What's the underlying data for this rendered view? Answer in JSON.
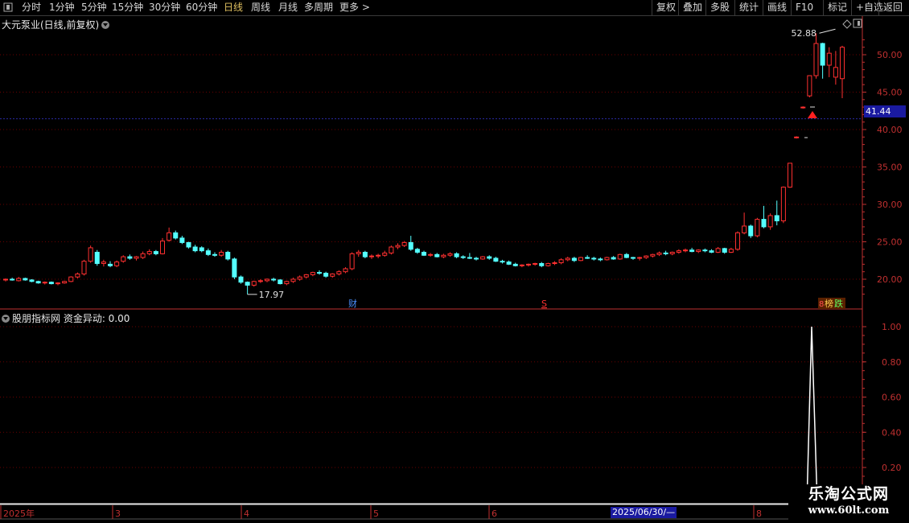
{
  "toolbar": {
    "periods": [
      "分时",
      "1分钟",
      "5分钟",
      "15分钟",
      "30分钟",
      "60分钟",
      "日线",
      "周线",
      "月线",
      "多周期",
      "更多 >"
    ],
    "active_period": "日线",
    "actions": [
      "复权",
      "叠加",
      "多股",
      "统计",
      "画线",
      "F10",
      "+自选",
      "返回"
    ],
    "marker": "标记"
  },
  "main_chart": {
    "title": "大元泵业(日线,前复权)",
    "high_label": "52.88",
    "low_label": "17.97",
    "current_price": "41.44",
    "y_ticks": [
      "50.00",
      "45.00",
      "40.00",
      "35.00",
      "30.00",
      "25.00",
      "20.00"
    ],
    "markers": {
      "cai": "财",
      "s": "S",
      "bang": "榜",
      "die": "跌"
    },
    "colors": {
      "up": "#ff3030",
      "down": "#54ffff",
      "grid": "#6a0000",
      "axis": "#c03030"
    }
  },
  "indicator": {
    "title": "股朋指标网 资金异动: 0.00",
    "y_ticks": [
      "1.00",
      "0.80",
      "0.60",
      "0.40",
      "0.20"
    ]
  },
  "time_axis": {
    "labels": [
      "2025年",
      "3",
      "4",
      "5",
      "6",
      "8"
    ],
    "cursor_date": "2025/06/30/—"
  },
  "watermark": {
    "title": "乐淘公式网",
    "url": "www.60lt.com"
  },
  "chart_data": {
    "type": "candlestick",
    "title": "大元泵业(日线,前复权)",
    "ylim": [
      17,
      54
    ],
    "candles": [
      [
        19.9,
        20.1,
        19.7,
        20.0
      ],
      [
        20.0,
        20.2,
        19.8,
        19.9
      ],
      [
        19.8,
        20.3,
        19.7,
        20.1
      ],
      [
        20.1,
        20.2,
        19.8,
        19.9
      ],
      [
        19.9,
        20.0,
        19.6,
        19.7
      ],
      [
        19.7,
        19.8,
        19.4,
        19.5
      ],
      [
        19.5,
        19.7,
        19.3,
        19.6
      ],
      [
        19.6,
        19.7,
        19.3,
        19.4
      ],
      [
        19.4,
        19.6,
        19.2,
        19.5
      ],
      [
        19.5,
        19.8,
        19.4,
        19.7
      ],
      [
        19.7,
        20.4,
        19.6,
        20.3
      ],
      [
        20.3,
        20.9,
        20.1,
        20.7
      ],
      [
        20.7,
        22.6,
        20.5,
        22.4
      ],
      [
        22.4,
        24.5,
        22.2,
        24.2
      ],
      [
        23.6,
        23.9,
        21.8,
        22.1
      ],
      [
        22.1,
        22.6,
        21.7,
        22.3
      ],
      [
        22.0,
        22.4,
        21.6,
        21.8
      ],
      [
        21.8,
        22.5,
        21.6,
        22.3
      ],
      [
        22.4,
        23.2,
        22.2,
        23.0
      ],
      [
        23.0,
        23.3,
        22.6,
        22.8
      ],
      [
        22.8,
        23.1,
        22.5,
        23.0
      ],
      [
        22.9,
        23.7,
        22.7,
        23.4
      ],
      [
        23.4,
        24.0,
        23.2,
        23.7
      ],
      [
        23.7,
        23.9,
        23.2,
        23.4
      ],
      [
        23.4,
        25.5,
        23.3,
        25.1
      ],
      [
        25.2,
        26.9,
        25.0,
        26.2
      ],
      [
        26.2,
        26.5,
        25.3,
        25.5
      ],
      [
        25.5,
        25.8,
        24.7,
        24.9
      ],
      [
        24.9,
        25.0,
        24.1,
        24.3
      ],
      [
        24.3,
        24.6,
        23.6,
        23.8
      ],
      [
        24.2,
        24.4,
        23.6,
        23.8
      ],
      [
        23.8,
        24.1,
        23.1,
        23.3
      ],
      [
        23.3,
        23.6,
        23.0,
        23.2
      ],
      [
        23.2,
        23.9,
        23.0,
        23.6
      ],
      [
        23.6,
        23.8,
        22.5,
        22.7
      ],
      [
        22.7,
        22.9,
        20.0,
        20.3
      ],
      [
        20.3,
        20.5,
        19.4,
        19.6
      ],
      [
        19.6,
        19.7,
        17.97,
        19.2
      ],
      [
        19.2,
        19.8,
        19.0,
        19.7
      ],
      [
        19.7,
        20.0,
        19.5,
        19.8
      ],
      [
        19.8,
        20.1,
        19.6,
        20.0
      ],
      [
        20.0,
        20.2,
        19.7,
        19.9
      ],
      [
        19.9,
        20.0,
        19.3,
        19.4
      ],
      [
        19.4,
        19.8,
        19.2,
        19.7
      ],
      [
        19.7,
        20.2,
        19.5,
        20.0
      ],
      [
        20.0,
        20.5,
        19.8,
        20.3
      ],
      [
        20.3,
        20.7,
        20.1,
        20.6
      ],
      [
        20.6,
        21.0,
        20.4,
        20.9
      ],
      [
        20.9,
        21.2,
        20.6,
        20.8
      ],
      [
        20.8,
        21.0,
        20.2,
        20.4
      ],
      [
        20.4,
        20.8,
        20.2,
        20.7
      ],
      [
        20.7,
        21.2,
        20.5,
        21.0
      ],
      [
        21.0,
        21.6,
        20.8,
        21.4
      ],
      [
        21.4,
        23.6,
        21.2,
        23.4
      ],
      [
        23.4,
        23.9,
        23.0,
        23.6
      ],
      [
        23.6,
        23.8,
        22.8,
        23.0
      ],
      [
        23.0,
        23.3,
        22.7,
        23.1
      ],
      [
        23.1,
        23.4,
        22.8,
        23.2
      ],
      [
        23.2,
        23.8,
        23.0,
        23.5
      ],
      [
        23.5,
        24.5,
        23.3,
        24.3
      ],
      [
        24.3,
        24.8,
        24.0,
        24.5
      ],
      [
        24.5,
        25.1,
        24.3,
        24.9
      ],
      [
        24.9,
        25.8,
        23.8,
        24.0
      ],
      [
        24.0,
        24.2,
        23.4,
        23.6
      ],
      [
        23.6,
        23.8,
        23.1,
        23.2
      ],
      [
        23.2,
        23.5,
        23.0,
        23.3
      ],
      [
        23.3,
        23.5,
        22.9,
        23.0
      ],
      [
        23.0,
        23.4,
        22.8,
        23.2
      ],
      [
        23.2,
        23.6,
        23.0,
        23.4
      ],
      [
        23.4,
        23.6,
        22.8,
        23.0
      ],
      [
        23.0,
        23.2,
        22.7,
        22.9
      ],
      [
        22.9,
        23.5,
        22.7,
        22.8
      ],
      [
        22.8,
        23.0,
        22.5,
        22.7
      ],
      [
        22.7,
        23.1,
        22.6,
        23.0
      ],
      [
        23.0,
        23.2,
        22.6,
        22.8
      ],
      [
        22.8,
        23.0,
        22.3,
        22.4
      ],
      [
        22.4,
        22.6,
        22.1,
        22.3
      ],
      [
        22.3,
        22.5,
        21.9,
        22.0
      ],
      [
        22.0,
        22.2,
        21.7,
        21.8
      ],
      [
        21.8,
        22.0,
        21.6,
        21.9
      ],
      [
        21.9,
        22.1,
        21.7,
        22.0
      ],
      [
        22.0,
        22.2,
        21.8,
        22.1
      ],
      [
        22.1,
        22.3,
        21.6,
        21.8
      ],
      [
        21.8,
        22.2,
        21.7,
        22.1
      ],
      [
        22.1,
        22.4,
        21.9,
        22.2
      ],
      [
        22.2,
        22.8,
        22.0,
        22.6
      ],
      [
        22.6,
        23.0,
        22.4,
        22.8
      ],
      [
        22.8,
        23.0,
        22.3,
        22.5
      ],
      [
        22.5,
        23.0,
        22.4,
        22.9
      ],
      [
        22.9,
        23.2,
        22.7,
        22.8
      ],
      [
        22.8,
        23.0,
        22.5,
        22.7
      ],
      [
        22.7,
        22.9,
        22.4,
        22.6
      ],
      [
        22.6,
        23.0,
        22.5,
        22.9
      ],
      [
        22.9,
        23.1,
        22.6,
        22.7
      ],
      [
        22.7,
        23.4,
        22.6,
        23.3
      ],
      [
        23.3,
        23.5,
        22.8,
        22.9
      ],
      [
        22.9,
        23.0,
        22.6,
        22.8
      ],
      [
        22.8,
        23.0,
        22.5,
        22.9
      ],
      [
        22.9,
        23.2,
        22.7,
        23.1
      ],
      [
        23.1,
        23.4,
        22.9,
        23.3
      ],
      [
        23.3,
        23.7,
        23.1,
        23.5
      ],
      [
        23.5,
        23.8,
        23.2,
        23.4
      ],
      [
        23.4,
        23.7,
        23.2,
        23.6
      ],
      [
        23.6,
        24.0,
        23.4,
        23.8
      ],
      [
        23.8,
        24.1,
        23.6,
        23.9
      ],
      [
        23.9,
        24.2,
        23.6,
        23.7
      ],
      [
        23.7,
        24.0,
        23.5,
        23.9
      ],
      [
        23.9,
        24.1,
        23.6,
        23.8
      ],
      [
        23.8,
        24.0,
        23.5,
        23.6
      ],
      [
        23.6,
        24.3,
        23.5,
        24.1
      ],
      [
        24.1,
        24.2,
        23.4,
        23.6
      ],
      [
        23.6,
        24.2,
        23.5,
        24.0
      ],
      [
        24.0,
        26.4,
        23.8,
        26.2
      ],
      [
        26.2,
        28.9,
        26.0,
        27.1
      ],
      [
        27.1,
        27.3,
        25.5,
        25.8
      ],
      [
        25.8,
        28.2,
        25.6,
        28.0
      ],
      [
        28.0,
        29.8,
        26.8,
        27.0
      ],
      [
        27.0,
        28.8,
        26.6,
        28.5
      ],
      [
        28.5,
        30.5,
        27.2,
        27.8
      ],
      [
        27.8,
        32.4,
        27.5,
        32.3
      ],
      [
        32.3,
        35.5,
        32.2,
        35.5
      ],
      [
        38.9,
        39.1,
        38.8,
        39.0
      ],
      [
        42.9,
        43.1,
        42.8,
        43.0
      ],
      [
        44.5,
        47.2,
        44.3,
        47.2
      ],
      [
        47.2,
        52.88,
        46.8,
        51.5
      ],
      [
        51.5,
        51.6,
        46.8,
        48.6
      ],
      [
        48.6,
        51.0,
        47.0,
        50.2
      ],
      [
        47.0,
        50.5,
        46.0,
        48.3
      ],
      [
        46.8,
        51.2,
        44.2,
        51.0
      ]
    ],
    "indicator": {
      "name": "资金异动",
      "value": 0.0,
      "spike_value": 1.0
    }
  }
}
